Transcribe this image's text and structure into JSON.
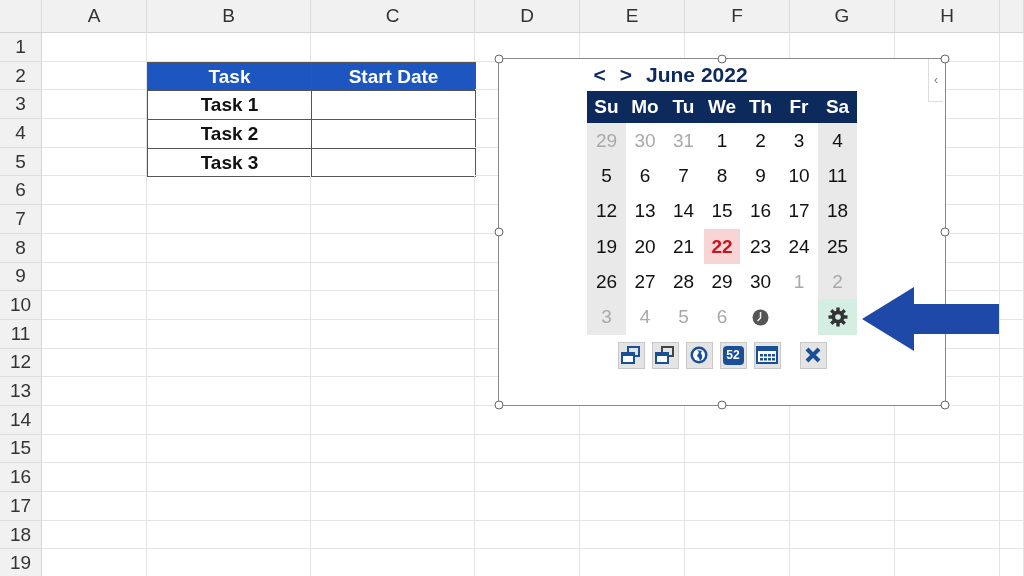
{
  "sheet": {
    "columns": [
      "A",
      "B",
      "C",
      "D",
      "E",
      "F",
      "G",
      "H"
    ],
    "rows": [
      "1",
      "2",
      "3",
      "4",
      "5",
      "6",
      "7",
      "8",
      "9",
      "10",
      "11",
      "12",
      "13",
      "14",
      "15",
      "16",
      "17",
      "18",
      "19"
    ]
  },
  "table": {
    "columns": [
      "Task",
      "Start Date"
    ],
    "rows": [
      {
        "task": "Task 1"
      },
      {
        "task": "Task 2"
      },
      {
        "task": "Task 3"
      }
    ]
  },
  "date_picker": {
    "prev": "<",
    "next": ">",
    "title": "June 2022",
    "collapse": "‹",
    "weekdays": [
      "Su",
      "Mo",
      "Tu",
      "We",
      "Th",
      "Fr",
      "Sa"
    ],
    "weeks": [
      [
        {
          "kind": "day",
          "day": "29",
          "outside": true,
          "selected": false
        },
        {
          "kind": "day",
          "day": "30",
          "outside": true,
          "selected": false
        },
        {
          "kind": "day",
          "day": "31",
          "outside": true,
          "selected": false
        },
        {
          "kind": "day",
          "day": "1",
          "outside": false,
          "selected": false
        },
        {
          "kind": "day",
          "day": "2",
          "outside": false,
          "selected": false
        },
        {
          "kind": "day",
          "day": "3",
          "outside": false,
          "selected": false
        },
        {
          "kind": "day",
          "day": "4",
          "outside": false,
          "selected": false
        }
      ],
      [
        {
          "kind": "day",
          "day": "5",
          "outside": false,
          "selected": false
        },
        {
          "kind": "day",
          "day": "6",
          "outside": false,
          "selected": false
        },
        {
          "kind": "day",
          "day": "7",
          "outside": false,
          "selected": false
        },
        {
          "kind": "day",
          "day": "8",
          "outside": false,
          "selected": false
        },
        {
          "kind": "day",
          "day": "9",
          "outside": false,
          "selected": false
        },
        {
          "kind": "day",
          "day": "10",
          "outside": false,
          "selected": false
        },
        {
          "kind": "day",
          "day": "11",
          "outside": false,
          "selected": false
        }
      ],
      [
        {
          "kind": "day",
          "day": "12",
          "outside": false,
          "selected": false
        },
        {
          "kind": "day",
          "day": "13",
          "outside": false,
          "selected": false
        },
        {
          "kind": "day",
          "day": "14",
          "outside": false,
          "selected": false
        },
        {
          "kind": "day",
          "day": "15",
          "outside": false,
          "selected": false
        },
        {
          "kind": "day",
          "day": "16",
          "outside": false,
          "selected": false
        },
        {
          "kind": "day",
          "day": "17",
          "outside": false,
          "selected": false
        },
        {
          "kind": "day",
          "day": "18",
          "outside": false,
          "selected": false
        }
      ],
      [
        {
          "kind": "day",
          "day": "19",
          "outside": false,
          "selected": false
        },
        {
          "kind": "day",
          "day": "20",
          "outside": false,
          "selected": false
        },
        {
          "kind": "day",
          "day": "21",
          "outside": false,
          "selected": false
        },
        {
          "kind": "day",
          "day": "22",
          "outside": false,
          "selected": true
        },
        {
          "kind": "day",
          "day": "23",
          "outside": false,
          "selected": false
        },
        {
          "kind": "day",
          "day": "24",
          "outside": false,
          "selected": false
        },
        {
          "kind": "day",
          "day": "25",
          "outside": false,
          "selected": false
        }
      ],
      [
        {
          "kind": "day",
          "day": "26",
          "outside": false,
          "selected": false
        },
        {
          "kind": "day",
          "day": "27",
          "outside": false,
          "selected": false
        },
        {
          "kind": "day",
          "day": "28",
          "outside": false,
          "selected": false
        },
        {
          "kind": "day",
          "day": "29",
          "outside": false,
          "selected": false
        },
        {
          "kind": "day",
          "day": "30",
          "outside": false,
          "selected": false
        },
        {
          "kind": "day",
          "day": "1",
          "outside": true,
          "selected": false
        },
        {
          "kind": "day",
          "day": "2",
          "outside": true,
          "selected": false
        }
      ],
      [
        {
          "kind": "day",
          "day": "3",
          "outside": true,
          "selected": false
        },
        {
          "kind": "day",
          "day": "4",
          "outside": true,
          "selected": false
        },
        {
          "kind": "day",
          "day": "5",
          "outside": true,
          "selected": false
        },
        {
          "kind": "day",
          "day": "6",
          "outside": true,
          "selected": false
        },
        {
          "kind": "clock"
        },
        {
          "kind": "empty"
        },
        {
          "kind": "settings"
        }
      ]
    ],
    "toolbar": [
      {
        "kind": "window"
      },
      {
        "kind": "window-dark"
      },
      {
        "kind": "globe"
      },
      {
        "kind": "week",
        "label": "52"
      },
      {
        "kind": "calendar"
      },
      {
        "kind": "close"
      }
    ]
  }
}
